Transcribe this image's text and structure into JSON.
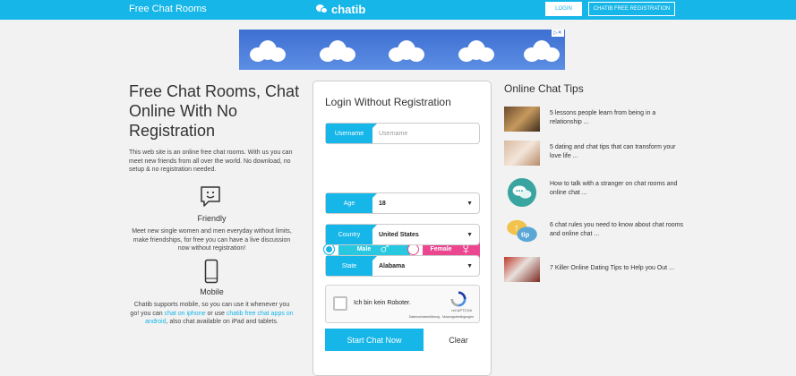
{
  "header": {
    "site_title": "Free Chat Rooms",
    "logo_text": "chatib",
    "login_label": "LOGIN",
    "register_label": "CHATIB FREE REGISTRATION",
    "accent_color": "#16b6e8"
  },
  "intro": {
    "heading": "Free Chat Rooms, Chat Online With No Registration",
    "description": "This web site is an online free chat rooms. With us you can meet new friends from all over the world. No download, no setup & no registration needed.",
    "features": [
      {
        "icon": "chat-bubble-smiley-icon",
        "title": "Friendly",
        "text": "Meet new single women and men everyday without limits, make friendships, for free you can have a live discussion now without registration!"
      },
      {
        "icon": "smartphone-icon",
        "title": "Mobile",
        "text_before": "Chatib supports mobile, so you can use it whenever you go! you can ",
        "link1": "chat on iphone",
        "text_middle": " or use ",
        "link2": "chatib free chat apps on android",
        "text_after": ", also chat available on iPad and tablets."
      }
    ]
  },
  "login": {
    "title": "Login Without Registration",
    "username_label": "Username",
    "username_placeholder": "Username",
    "male_label": "Male",
    "female_label": "Female",
    "male_color": "#28c8e0",
    "female_color": "#ec4690",
    "age_label": "Age",
    "age_value": "18",
    "country_label": "Country",
    "country_value": "United States",
    "state_label": "State",
    "state_value": "Alabama",
    "captcha_label": "Ich bin kein Roboter.",
    "captcha_brand": "reCAPTCHA",
    "captcha_privacy": "Datenschutzerklärung - Nutzungsbedingungen",
    "start_label": "Start Chat Now",
    "clear_label": "Clear"
  },
  "tips": {
    "title": "Online Chat Tips",
    "items": [
      {
        "text": "5 lessons people learn from being in a relationship ...",
        "thumb": "couple-photo"
      },
      {
        "text": "5 dating and chat tips that can transform your love life ...",
        "thumb": "hands-photo"
      },
      {
        "text": "How to talk with a stranger on chat rooms and online chat ...",
        "thumb": "chat-circle-icon"
      },
      {
        "text": "6 chat rules you need to know about chat rooms and online chat ...",
        "thumb": "tip-bubbles-icon"
      },
      {
        "text": "7 Killer Online Dating Tips to Help you Out ...",
        "thumb": "dating-photo"
      }
    ]
  }
}
